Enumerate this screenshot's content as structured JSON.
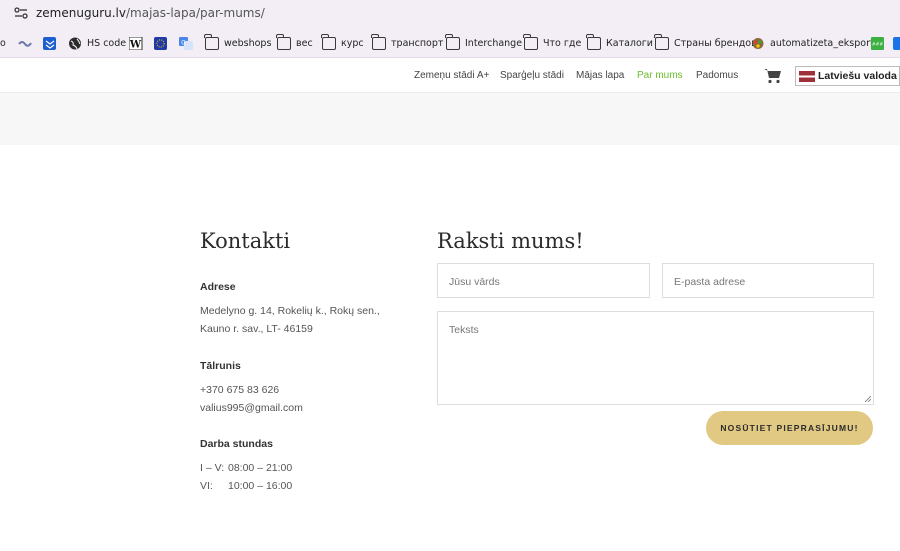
{
  "browser": {
    "url_host": "zemenuguru.lv",
    "url_path": "/majas-lapa/par-mums/",
    "bookmarks": [
      {
        "label": "о",
        "icon": "partial-icon"
      },
      {
        "label": "",
        "icon": "link-icon"
      },
      {
        "label": "",
        "icon": "dropbox-icon"
      },
      {
        "label": "HS code",
        "icon": "globe-icon"
      },
      {
        "label": "",
        "icon": "w-icon"
      },
      {
        "label": "",
        "icon": "eu-flag-icon"
      },
      {
        "label": "",
        "icon": "translate-icon"
      },
      {
        "label": "webshops",
        "icon": "folder-icon"
      },
      {
        "label": "вес",
        "icon": "folder-icon"
      },
      {
        "label": "курс",
        "icon": "folder-icon"
      },
      {
        "label": "транспорт",
        "icon": "folder-icon"
      },
      {
        "label": "Interchange",
        "icon": "folder-icon"
      },
      {
        "label": "Что где",
        "icon": "folder-icon"
      },
      {
        "label": "Каталоги",
        "icon": "folder-icon"
      },
      {
        "label": "Страны брендов",
        "icon": "folder-icon"
      },
      {
        "label": "automatizeta_eksport...",
        "icon": "app-icon"
      },
      {
        "label": "",
        "icon": "green-app-icon"
      },
      {
        "label": "",
        "icon": "extension-icon"
      }
    ]
  },
  "nav": {
    "items": [
      "Zemeņu stādi A+",
      "Sparģeļu stādi",
      "Mājas lapa",
      "Par mums",
      "Padomus"
    ],
    "active_index": 3,
    "language": "Latviešu valoda",
    "active_color": "#6bbf2a"
  },
  "contacts": {
    "title": "Kontakti",
    "address_label": "Adrese",
    "address_line1": "Medelyno g. 14, Rokelių k., Rokų sen.,",
    "address_line2": "Kauno r. sav., LT- 46159",
    "phone_label": "Tālrunis",
    "phone": "+370 675 83 626",
    "email": "valius995@gmail.com",
    "hours_label": "Darba stundas",
    "hours": [
      {
        "day": "I –  V:",
        "time": "08:00 – 21:00"
      },
      {
        "day": "VI:",
        "time": "10:00 – 16:00"
      }
    ]
  },
  "form": {
    "title": "Raksti mums!",
    "name_placeholder": "Jūsu vārds",
    "email_placeholder": "E-pasta adrese",
    "message_placeholder": "Teksts",
    "submit_label": "NOSŪTIET PIEPRASĪJUMU!",
    "button_color": "#e1c984"
  }
}
